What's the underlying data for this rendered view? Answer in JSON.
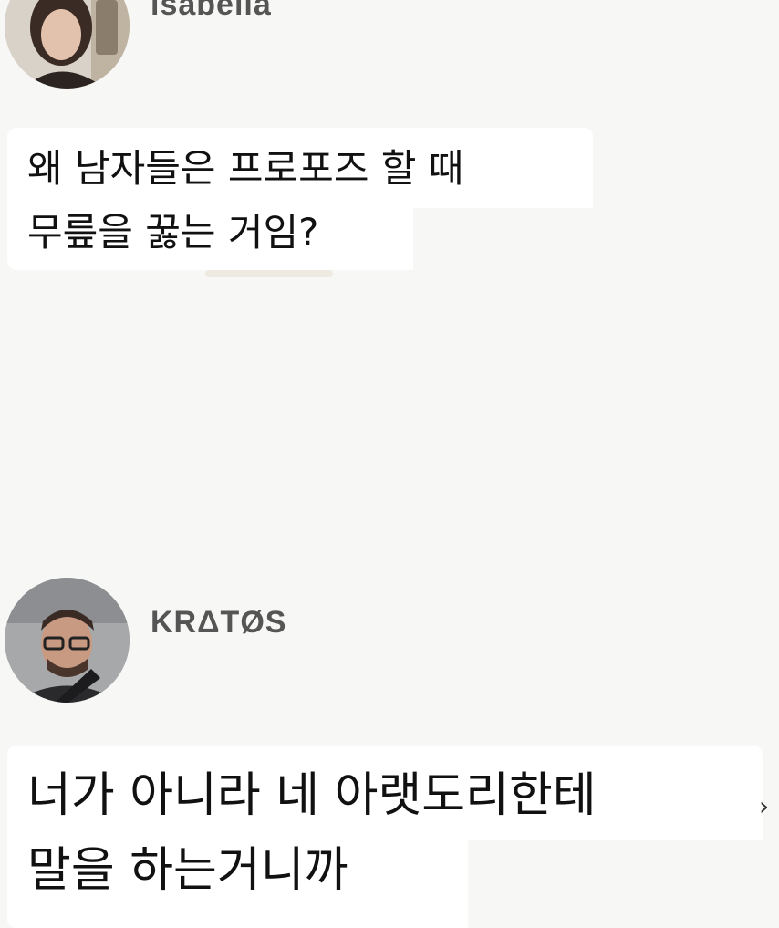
{
  "posts": [
    {
      "username": "isabella",
      "avatar_icon": "user-avatar-icon",
      "message_lines": [
        "왜 남자들은 프로포즈 할 때",
        "무릎을 꿇는 거임?"
      ]
    },
    {
      "username": "KRΔTØS",
      "avatar_icon": "user-avatar-icon",
      "message_lines": [
        "너가 아니라 네 아랫도리한테",
        "말을 하는거니까"
      ],
      "edge_glyph": "›"
    }
  ]
}
